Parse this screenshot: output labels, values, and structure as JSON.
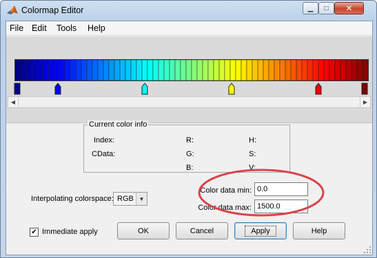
{
  "window": {
    "title": "Colormap Editor"
  },
  "title_buttons": {
    "minimize_glyph": "▁",
    "maximize_glyph": "□",
    "close_glyph": "✕"
  },
  "menu": {
    "file": "File",
    "edit": "Edit",
    "tools": "Tools",
    "help": "Help"
  },
  "colormap": {
    "name": "jet",
    "segments": 64,
    "markers": [
      {
        "position": 0.0,
        "color": "#00008f"
      },
      {
        "position": 0.117,
        "color": "#0000ff"
      },
      {
        "position": 0.367,
        "color": "#00ffff"
      },
      {
        "position": 0.617,
        "color": "#ffff00"
      },
      {
        "position": 0.867,
        "color": "#ff0000"
      },
      {
        "position": 1.0,
        "color": "#800000"
      }
    ]
  },
  "info": {
    "group_title": "Current color info",
    "index_label": "Index:",
    "cdata_label": "CData:",
    "r_label": "R:",
    "g_label": "G:",
    "b_label": "B:",
    "h_label": "H:",
    "s_label": "S:",
    "v_label": "V:"
  },
  "interpolation": {
    "label": "Interpolating colorspace:",
    "value": "RGB"
  },
  "color_data": {
    "min_label": "Color data min:",
    "min_value": "0.0",
    "max_label": "Color data max:",
    "max_value": "1500.0"
  },
  "immediate_apply": {
    "label": "Immediate apply",
    "checked": true
  },
  "buttons": {
    "ok": "OK",
    "cancel": "Cancel",
    "apply": "Apply",
    "help": "Help"
  },
  "colors": {
    "annotation": "#d9434b",
    "accent": "#3c7fb1"
  }
}
